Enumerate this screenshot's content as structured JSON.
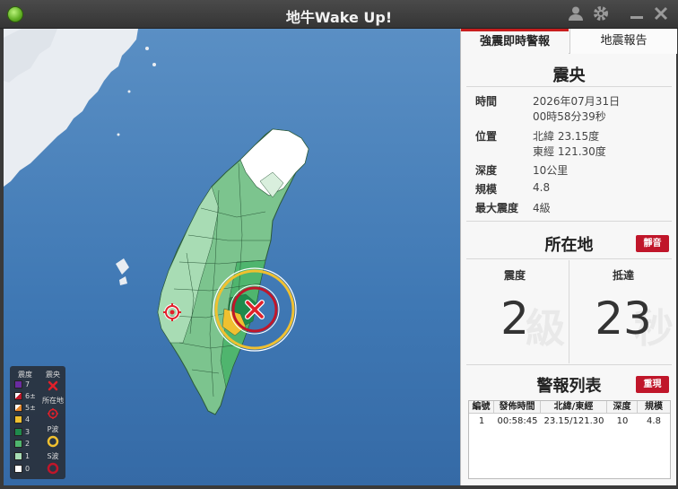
{
  "window": {
    "title": "地牛Wake Up!"
  },
  "titlebar_icons": [
    "user-icon",
    "gear-icon",
    "minimize-icon",
    "close-icon"
  ],
  "tabs": [
    {
      "label": "強震即時警報",
      "active": true
    },
    {
      "label": "地震報告",
      "active": false
    }
  ],
  "epicenter": {
    "title": "震央",
    "rows": [
      {
        "label": "時間",
        "value": "2026年07月31日",
        "value2": "00時58分39秒"
      },
      {
        "label": "位置",
        "value": "北緯 23.15度",
        "value2": "東經 121.30度"
      },
      {
        "label": "深度",
        "value": "10公里"
      },
      {
        "label": "規模",
        "value": "4.8"
      },
      {
        "label": "最大震度",
        "value": "4級"
      }
    ]
  },
  "location": {
    "title": "所在地",
    "mute_label": "靜音",
    "intensity_label": "震度",
    "intensity_value": "2",
    "intensity_bg": "級",
    "arrival_label": "抵達",
    "arrival_value": "23",
    "arrival_bg": "秒"
  },
  "alerts": {
    "title": "警報列表",
    "replay_label": "重現",
    "columns": [
      "編號",
      "發佈時間",
      "北緯/東經",
      "深度",
      "規模"
    ],
    "rows": [
      [
        "1",
        "00:58:45",
        "23.15/121.30",
        "10",
        "4.8"
      ]
    ]
  },
  "legend": {
    "intensity_header": "震度",
    "epicenter_header": "震央",
    "levels": [
      {
        "label": "7",
        "color": "#6a2ca0"
      },
      {
        "label": "6±",
        "color": "#c0162a"
      },
      {
        "label": "5±",
        "color": "#e8882a"
      },
      {
        "label": "4",
        "color": "#f0c030"
      },
      {
        "label": "3",
        "color": "#1f8a4c"
      },
      {
        "label": "2",
        "color": "#4fb56e"
      },
      {
        "label": "1",
        "color": "#a8dcb4"
      },
      {
        "label": "0",
        "color": "#ffffff"
      }
    ],
    "location_label": "所在地",
    "pwave_label": "P波",
    "swave_label": "S波"
  },
  "colors": {
    "accent": "#c0162a",
    "sea": "#4a82bc",
    "land_light": "#a8dcb4",
    "land_mid": "#4fb56e"
  }
}
